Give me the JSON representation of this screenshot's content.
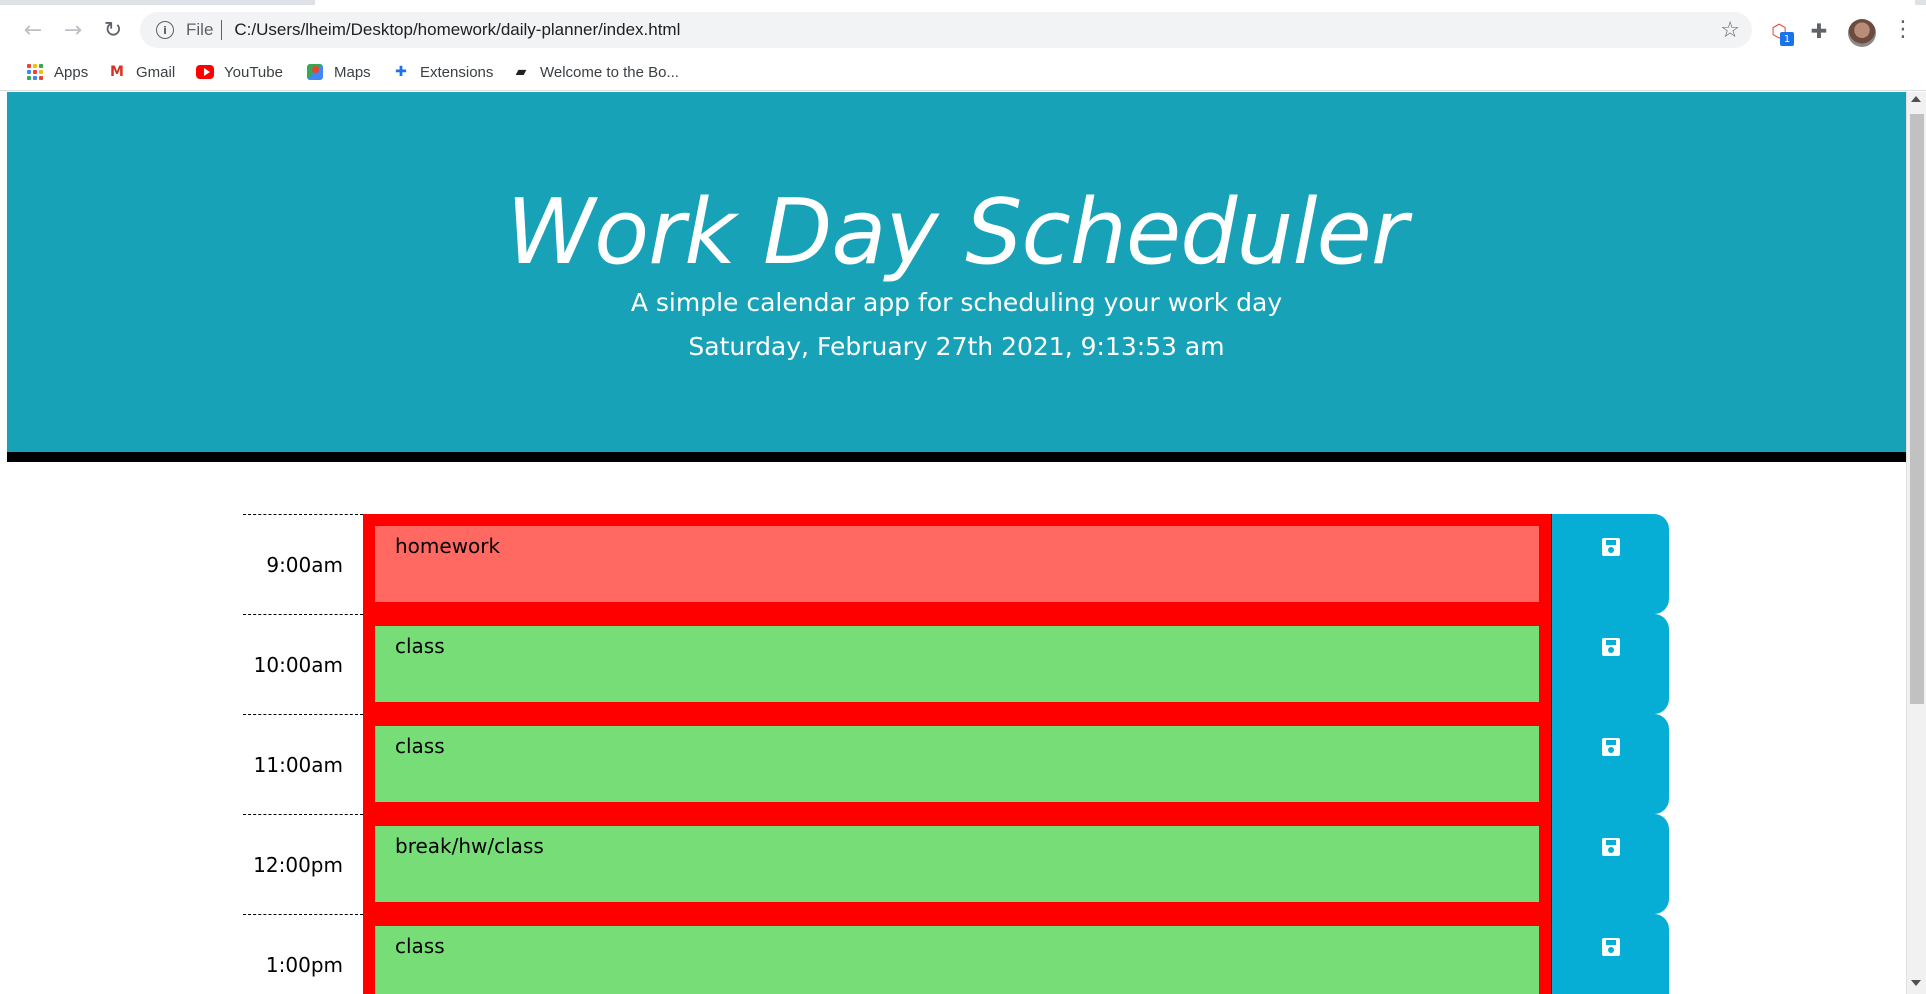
{
  "browser": {
    "scheme": "File",
    "url": "C:/Users/lheim/Desktop/homework/daily-planner/index.html",
    "extension_badge": "1",
    "icons": {
      "back": "arrow-left-icon",
      "forward": "arrow-right-icon",
      "reload": "reload-icon",
      "info": "info-icon",
      "star": "star-icon",
      "extensions": "puzzle-icon",
      "menu": "kebab-icon"
    }
  },
  "bookmarks": [
    {
      "label": "Apps",
      "icon": "apps-grid-icon"
    },
    {
      "label": "Gmail",
      "icon": "gmail-icon"
    },
    {
      "label": "YouTube",
      "icon": "youtube-icon"
    },
    {
      "label": "Maps",
      "icon": "maps-icon"
    },
    {
      "label": "Extensions",
      "icon": "puzzle-icon"
    },
    {
      "label": "Welcome to the Bo...",
      "icon": "book-icon"
    }
  ],
  "header": {
    "title": "Work Day Scheduler",
    "lead": "A simple calendar app for scheduling your work day",
    "current_day": "Saturday, February 27th 2021, 9:13:53 am"
  },
  "colors": {
    "header_bg": "#17a2b8",
    "past": "#ff6961",
    "future": "#77dd77",
    "border": "#ff0000",
    "save": "#06aed5"
  },
  "timeblocks": [
    {
      "hour": "9:00am",
      "text": "homework",
      "state": "past"
    },
    {
      "hour": "10:00am",
      "text": "class",
      "state": "future"
    },
    {
      "hour": "11:00am",
      "text": "class",
      "state": "future"
    },
    {
      "hour": "12:00pm",
      "text": "break/hw/class",
      "state": "future"
    },
    {
      "hour": "1:00pm",
      "text": "class",
      "state": "future"
    }
  ]
}
